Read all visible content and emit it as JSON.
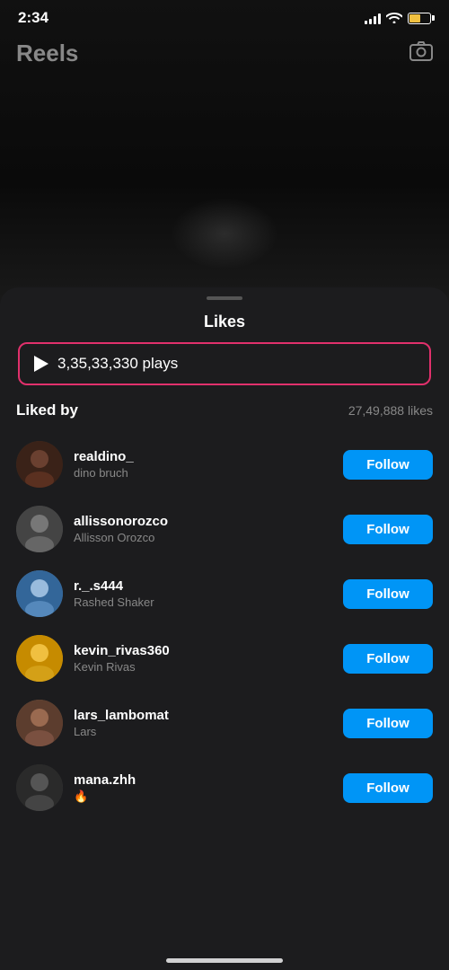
{
  "statusBar": {
    "time": "2:34",
    "signal": [
      3,
      5,
      7,
      9,
      11
    ],
    "batteryLevel": "55%"
  },
  "topBar": {
    "title": "Reels",
    "cameraIcon": "📷"
  },
  "sheet": {
    "title": "Likes",
    "playsText": "3,35,33,330 plays",
    "likedByLabel": "Liked by",
    "likesCount": "27,49,888 likes",
    "users": [
      {
        "username": "realdino_",
        "displayName": "dino bruch",
        "followLabel": "Follow",
        "avatarClass": "av-1"
      },
      {
        "username": "allissonorozco",
        "displayName": "Allisson Orozco",
        "followLabel": "Follow",
        "avatarClass": "av-2"
      },
      {
        "username": "r._.s444",
        "displayName": "Rashed Shaker",
        "followLabel": "Follow",
        "avatarClass": "av-3"
      },
      {
        "username": "kevin_rivas360",
        "displayName": "Kevin Rivas",
        "followLabel": "Follow",
        "avatarClass": "av-4"
      },
      {
        "username": "lars_lambomat",
        "displayName": "Lars",
        "followLabel": "Follow",
        "avatarClass": "av-5"
      },
      {
        "username": "mana.zhh",
        "displayName": "🔥",
        "followLabel": "Follow",
        "avatarClass": "av-6"
      }
    ]
  }
}
